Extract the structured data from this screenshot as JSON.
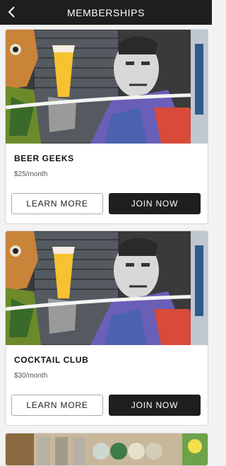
{
  "header": {
    "title": "MEMBERSHIPS",
    "back_icon": "chevron-left-icon"
  },
  "memberships": [
    {
      "title": "BEER GEEKS",
      "price": "$25/month",
      "learn_label": "LEARN MORE",
      "join_label": "JOIN NOW"
    },
    {
      "title": "COCKTAIL CLUB",
      "price": "$30/month",
      "learn_label": "LEARN MORE",
      "join_label": "JOIN NOW"
    }
  ],
  "colors": {
    "header_bg": "#1c1f1c",
    "join_bg": "#1c1f1c",
    "page_bg": "#f2f2f2"
  }
}
